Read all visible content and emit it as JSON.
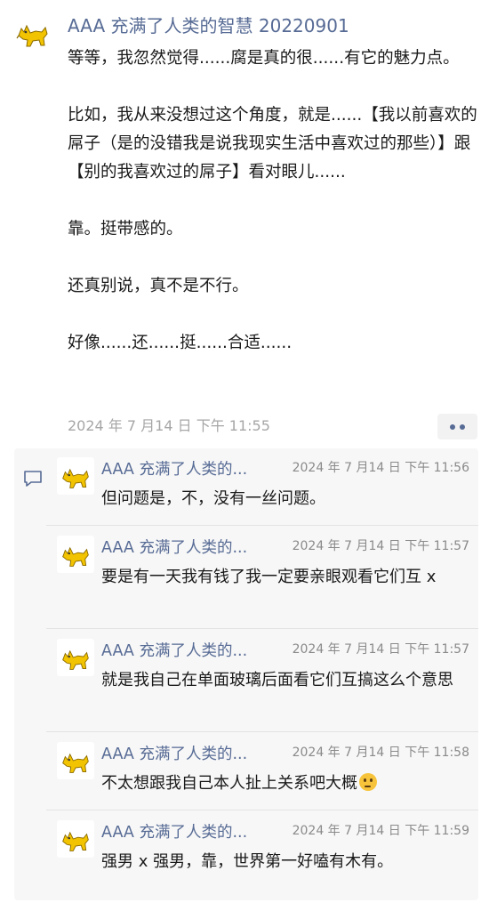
{
  "post": {
    "author": "AAA 充满了人类的智慧 20220901",
    "text": "等等，我忽然觉得......腐是真的很......有它的魅力点。\n\n比如，我从来没想过这个角度，就是......【我以前喜欢的屌子（是的没错我是说我现实生活中喜欢过的那些）】跟【别的我喜欢过的屌子】看对眼儿......\n\n靠。挺带感的。\n\n还真别说，真不是不行。\n\n好像......还......挺......合适......",
    "time": "2024 年 7 月14 日 下午 11:55",
    "avatar_icon": "yellow-cat-icon",
    "more_icon": "more-dots-icon"
  },
  "colors": {
    "name_blue": "#576b95",
    "time_gray": "#a6a6a6",
    "panel_bg": "#f7f7f7",
    "avatar_yellow": "#f2c300"
  },
  "comments_icon": "comment-bubble-icon",
  "comments": [
    {
      "author": "AAA 充满了人类的...",
      "time": "2024 年 7 月14 日 下午 11:56",
      "text": "但问题是，不，没有一丝问题。"
    },
    {
      "author": "AAA 充满了人类的...",
      "time": "2024 年 7 月14 日 下午 11:57",
      "text": "要是有一天我有钱了我一定要亲眼观看它们互 x"
    },
    {
      "author": "AAA 充满了人类的...",
      "time": "2024 年 7 月14 日 下午 11:57",
      "text": "就是我自己在单面玻璃后面看它们互搞这么个意思"
    },
    {
      "author": "AAA 充满了人类的...",
      "time": "2024 年 7 月14 日 下午 11:58",
      "text": "不太想跟我自己本人扯上关系吧大概",
      "emoji": "thinking-face-icon"
    },
    {
      "author": "AAA 充满了人类的...",
      "time": "2024 年 7 月14 日 下午 11:59",
      "text": "强男 x 强男，靠，世界第一好嗑有木有。"
    }
  ]
}
